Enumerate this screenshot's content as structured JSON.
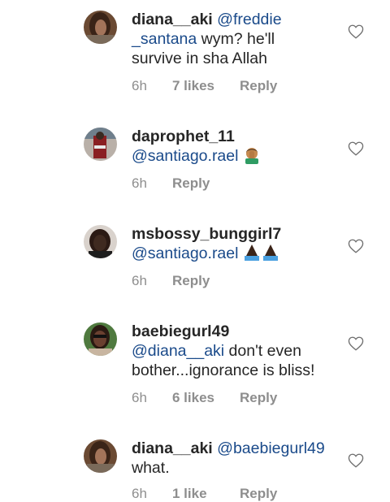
{
  "comments": [
    {
      "username": "diana__aki",
      "mention": "@freddie _santana",
      "mention_line1": "@freddie",
      "mention_line2": "_santana",
      "text": "wym? he'll survive in sha Allah",
      "text_line1": "wym? he'll",
      "text_line2": "survive in sha Allah",
      "time": "6h",
      "likes": "7 likes",
      "reply": "Reply"
    },
    {
      "username": "daprophet_11",
      "mention": "@santiago.rael",
      "text": "",
      "emoji": "man-facepalming-emoji",
      "time": "6h",
      "reply": "Reply"
    },
    {
      "username": "msbossy_bunggirl7",
      "mention": "@santiago.rael",
      "text": "",
      "emoji": "folded-hands-emoji",
      "time": "6h",
      "reply": "Reply"
    },
    {
      "username": "baebiegurl49",
      "mention": "@diana__aki",
      "text": "don't even bother...ignorance is bliss!",
      "text_line1": "don't even",
      "text_line2": "bother...ignorance is bliss!",
      "time": "6h",
      "likes": "6 likes",
      "reply": "Reply"
    },
    {
      "username": "diana__aki",
      "mention": "@baebiegurl49",
      "text": "what.",
      "time": "6h",
      "likes": "1 like",
      "reply": "Reply"
    }
  ],
  "colors": {
    "mention": "#1a4a8a",
    "meta": "#8e8e8e",
    "text": "#262626"
  }
}
